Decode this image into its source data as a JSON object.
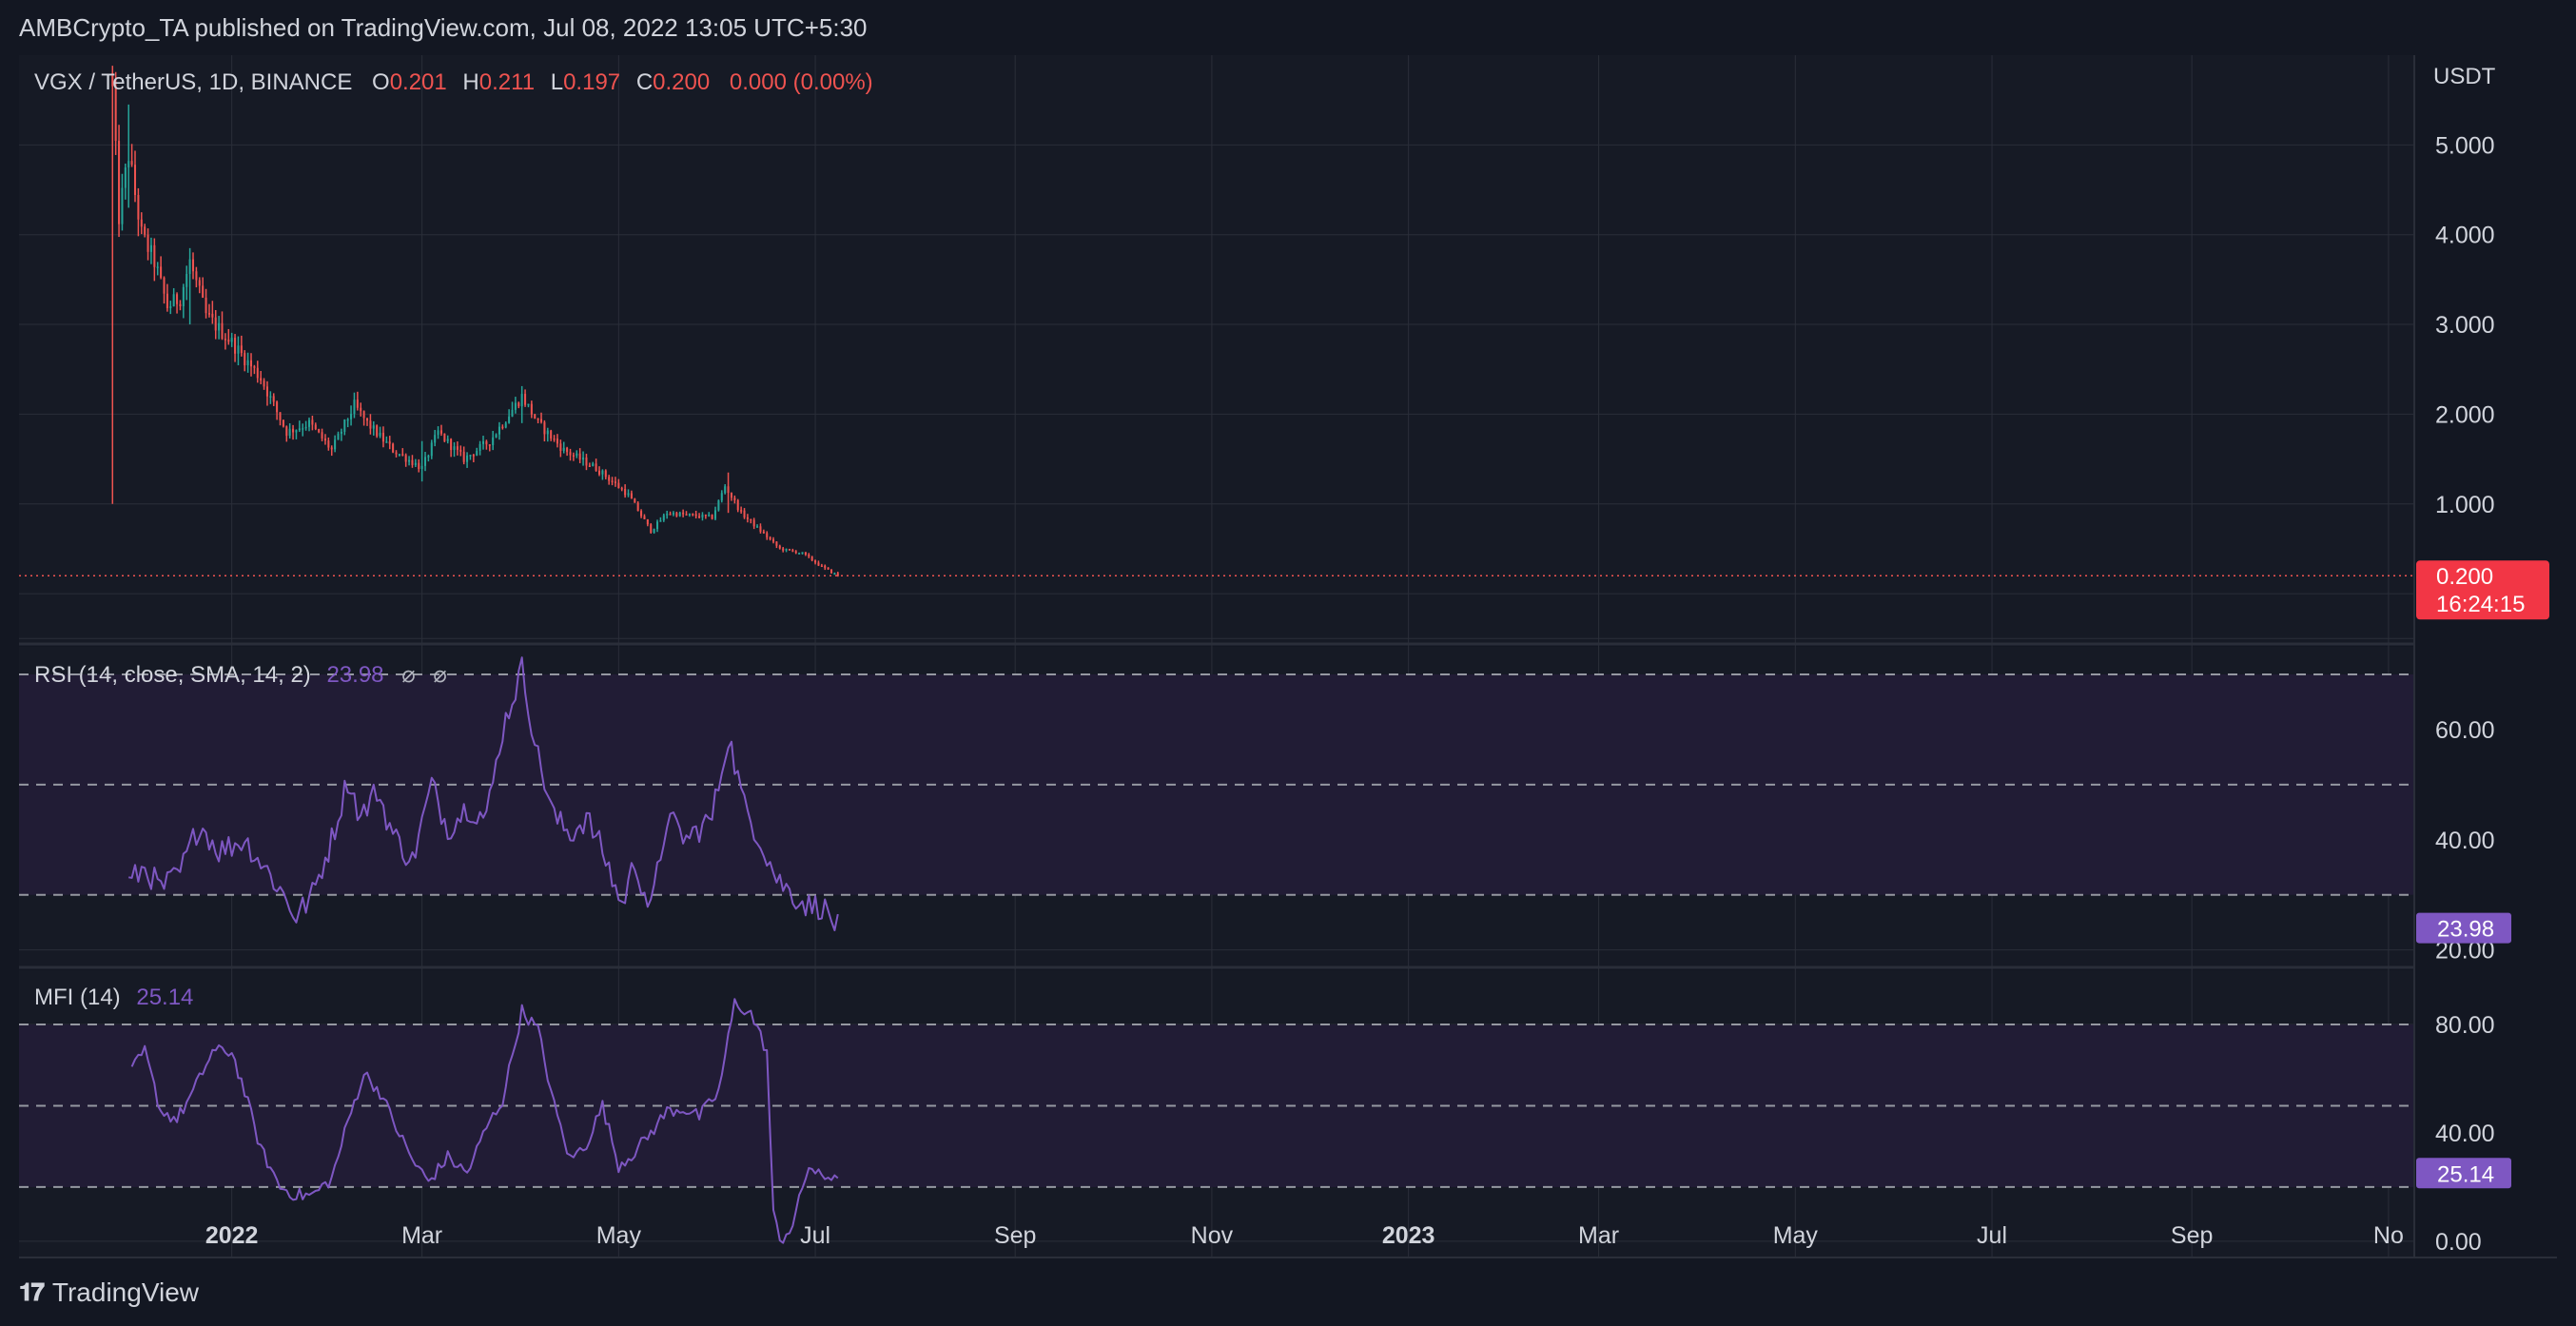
{
  "header": {
    "publisher_line": "AMBCrypto_TA published on TradingView.com, Jul 08, 2022 13:05 UTC+5:30"
  },
  "footer": {
    "brand_label": "TradingView"
  },
  "colors": {
    "background": "#131722",
    "pane_bg": "#161a25",
    "grid": "#2a2e39",
    "text": "#d1d4dc",
    "up": "#26a69a",
    "down": "#ef5350",
    "indicator": "#7e57c2",
    "band_fill": "#211c35"
  },
  "chart_data": [
    {
      "type": "candlestick",
      "legend": {
        "symbol": "VGX / TetherUS, 1D, BINANCE",
        "o_label": "O",
        "o_value": "0.201",
        "h_label": "H",
        "h_value": "0.211",
        "l_label": "L",
        "l_value": "0.197",
        "c_label": "C",
        "c_value": "0.200",
        "change": "0.000 (0.00%)"
      },
      "currency_label": "USDT",
      "y_ticks": [
        "1.000",
        "2.000",
        "3.000",
        "4.000",
        "5.000"
      ],
      "ylim": [
        -0.55,
        6.0
      ],
      "last_price_label": "0.200",
      "countdown_label": "16:24:15",
      "last_price": 0.2,
      "series_start": "2021-11-25",
      "series_end": "2022-07-08",
      "anchors_close": [
        [
          "2021-11-25",
          5.6
        ],
        [
          "2021-11-27",
          4.2
        ],
        [
          "2021-11-30",
          4.9
        ],
        [
          "2021-12-04",
          4.0
        ],
        [
          "2021-12-08",
          3.7
        ],
        [
          "2021-12-12",
          3.2
        ],
        [
          "2021-12-16",
          3.3
        ],
        [
          "2021-12-19",
          3.7
        ],
        [
          "2021-12-24",
          3.1
        ],
        [
          "2022-01-01",
          2.8
        ],
        [
          "2022-01-10",
          2.4
        ],
        [
          "2022-01-18",
          1.8
        ],
        [
          "2022-01-25",
          1.9
        ],
        [
          "2022-02-01",
          1.6
        ],
        [
          "2022-02-08",
          2.1
        ],
        [
          "2022-02-12",
          1.9
        ],
        [
          "2022-02-20",
          1.6
        ],
        [
          "2022-03-01",
          1.4
        ],
        [
          "2022-03-06",
          1.8
        ],
        [
          "2022-03-14",
          1.5
        ],
        [
          "2022-03-22",
          1.7
        ],
        [
          "2022-04-01",
          2.2
        ],
        [
          "2022-04-06",
          1.9
        ],
        [
          "2022-04-14",
          1.6
        ],
        [
          "2022-04-24",
          1.4
        ],
        [
          "2022-05-04",
          1.1
        ],
        [
          "2022-05-11",
          0.7
        ],
        [
          "2022-05-16",
          0.9
        ],
        [
          "2022-05-30",
          0.85
        ],
        [
          "2022-06-03",
          1.2
        ],
        [
          "2022-06-08",
          0.9
        ],
        [
          "2022-06-14",
          0.7
        ],
        [
          "2022-06-20",
          0.5
        ],
        [
          "2022-06-27",
          0.45
        ],
        [
          "2022-07-03",
          0.3
        ],
        [
          "2022-07-08",
          0.2
        ]
      ],
      "spikes": [
        {
          "date": "2021-11-25",
          "high": 5.8,
          "low": 1.0
        },
        {
          "date": "2021-11-30",
          "high": 5.45,
          "low": 4.3
        },
        {
          "date": "2021-12-19",
          "high": 3.85,
          "low": 3.0
        },
        {
          "date": "2022-04-01",
          "high": 2.3,
          "low": 1.9
        },
        {
          "date": "2022-06-04",
          "high": 1.35,
          "low": 0.9
        },
        {
          "date": "2022-03-01",
          "high": 1.7,
          "low": 1.25
        }
      ]
    },
    {
      "type": "line",
      "legend_label": "RSI (14, close, SMA, 14, 2)",
      "legend_value": "23.98",
      "legend_icons": [
        "⌀",
        "⌀"
      ],
      "ylim": [
        17,
        75
      ],
      "y_ticks": [
        "20.00",
        "40.00",
        "60.00"
      ],
      "bands": [
        30,
        50,
        70
      ],
      "last_value": 23.98,
      "series_start": "2021-11-30",
      "series_end": "2022-07-08",
      "anchors": [
        [
          "2021-11-30",
          32
        ],
        [
          "2021-12-05",
          35
        ],
        [
          "2021-12-10",
          31
        ],
        [
          "2021-12-16",
          34
        ],
        [
          "2021-12-22",
          43
        ],
        [
          "2021-12-28",
          38
        ],
        [
          "2022-01-05",
          40
        ],
        [
          "2022-01-10",
          36
        ],
        [
          "2022-01-16",
          31
        ],
        [
          "2022-01-21",
          26
        ],
        [
          "2022-01-26",
          30
        ],
        [
          "2022-02-01",
          40
        ],
        [
          "2022-02-06",
          51
        ],
        [
          "2022-02-10",
          44
        ],
        [
          "2022-02-15",
          49
        ],
        [
          "2022-02-20",
          41
        ],
        [
          "2022-02-26",
          36
        ],
        [
          "2022-03-04",
          50
        ],
        [
          "2022-03-09",
          42
        ],
        [
          "2022-03-15",
          46
        ],
        [
          "2022-03-21",
          44
        ],
        [
          "2022-03-26",
          60
        ],
        [
          "2022-04-01",
          71
        ],
        [
          "2022-04-06",
          55
        ],
        [
          "2022-04-11",
          44
        ],
        [
          "2022-04-16",
          41
        ],
        [
          "2022-04-21",
          44
        ],
        [
          "2022-04-26",
          38
        ],
        [
          "2022-05-02",
          28
        ],
        [
          "2022-05-06",
          36
        ],
        [
          "2022-05-11",
          27
        ],
        [
          "2022-05-16",
          44
        ],
        [
          "2022-05-22",
          40
        ],
        [
          "2022-05-30",
          44
        ],
        [
          "2022-06-04",
          59
        ],
        [
          "2022-06-09",
          46
        ],
        [
          "2022-06-14",
          40
        ],
        [
          "2022-06-19",
          33
        ],
        [
          "2022-06-24",
          30
        ],
        [
          "2022-06-29",
          28
        ],
        [
          "2022-07-03",
          28
        ],
        [
          "2022-07-08",
          24
        ]
      ]
    },
    {
      "type": "line",
      "legend_label": "MFI (14)",
      "legend_value": "25.14",
      "ylim": [
        -6,
        100
      ],
      "y_ticks": [
        "0.00",
        "40.00",
        "80.00"
      ],
      "bands": [
        20,
        50,
        80
      ],
      "last_value": 25.14,
      "series_start": "2021-12-01",
      "series_end": "2022-07-08",
      "anchors": [
        [
          "2021-12-01",
          63
        ],
        [
          "2021-12-05",
          70
        ],
        [
          "2021-12-10",
          48
        ],
        [
          "2021-12-15",
          45
        ],
        [
          "2021-12-20",
          55
        ],
        [
          "2021-12-26",
          70
        ],
        [
          "2022-01-01",
          70
        ],
        [
          "2022-01-05",
          55
        ],
        [
          "2022-01-10",
          34
        ],
        [
          "2022-01-16",
          20
        ],
        [
          "2022-01-21",
          17
        ],
        [
          "2022-01-26",
          17
        ],
        [
          "2022-02-01",
          23
        ],
        [
          "2022-02-06",
          44
        ],
        [
          "2022-02-11",
          62
        ],
        [
          "2022-02-16",
          55
        ],
        [
          "2022-02-21",
          42
        ],
        [
          "2022-02-26",
          30
        ],
        [
          "2022-03-03",
          22
        ],
        [
          "2022-03-09",
          31
        ],
        [
          "2022-03-15",
          25
        ],
        [
          "2022-03-21",
          42
        ],
        [
          "2022-03-26",
          52
        ],
        [
          "2022-04-01",
          85
        ],
        [
          "2022-04-06",
          78
        ],
        [
          "2022-04-11",
          50
        ],
        [
          "2022-04-16",
          30
        ],
        [
          "2022-04-21",
          36
        ],
        [
          "2022-04-26",
          50
        ],
        [
          "2022-05-01",
          28
        ],
        [
          "2022-05-06",
          33
        ],
        [
          "2022-05-11",
          40
        ],
        [
          "2022-05-16",
          48
        ],
        [
          "2022-05-21",
          49
        ],
        [
          "2022-05-26",
          46
        ],
        [
          "2022-06-01",
          55
        ],
        [
          "2022-06-06",
          88
        ],
        [
          "2022-06-11",
          84
        ],
        [
          "2022-06-16",
          70
        ],
        [
          "2022-06-18",
          10
        ],
        [
          "2022-06-20",
          0
        ],
        [
          "2022-06-24",
          6
        ],
        [
          "2022-06-29",
          28
        ],
        [
          "2022-07-03",
          23
        ],
        [
          "2022-07-08",
          25
        ]
      ]
    }
  ],
  "x_axis": {
    "ticks": [
      {
        "label": "2022",
        "date": "2022-01-01",
        "bold": true
      },
      {
        "label": "Mar",
        "date": "2022-03-01"
      },
      {
        "label": "May",
        "date": "2022-05-01"
      },
      {
        "label": "Jul",
        "date": "2022-07-01"
      },
      {
        "label": "Sep",
        "date": "2022-09-01"
      },
      {
        "label": "Nov",
        "date": "2022-11-01"
      },
      {
        "label": "2023",
        "date": "2023-01-01",
        "bold": true
      },
      {
        "label": "Mar",
        "date": "2023-03-01"
      },
      {
        "label": "May",
        "date": "2023-05-01"
      },
      {
        "label": "Jul",
        "date": "2023-07-01"
      },
      {
        "label": "Sep",
        "date": "2023-09-01"
      },
      {
        "label": "No",
        "date": "2023-11-01"
      }
    ]
  }
}
